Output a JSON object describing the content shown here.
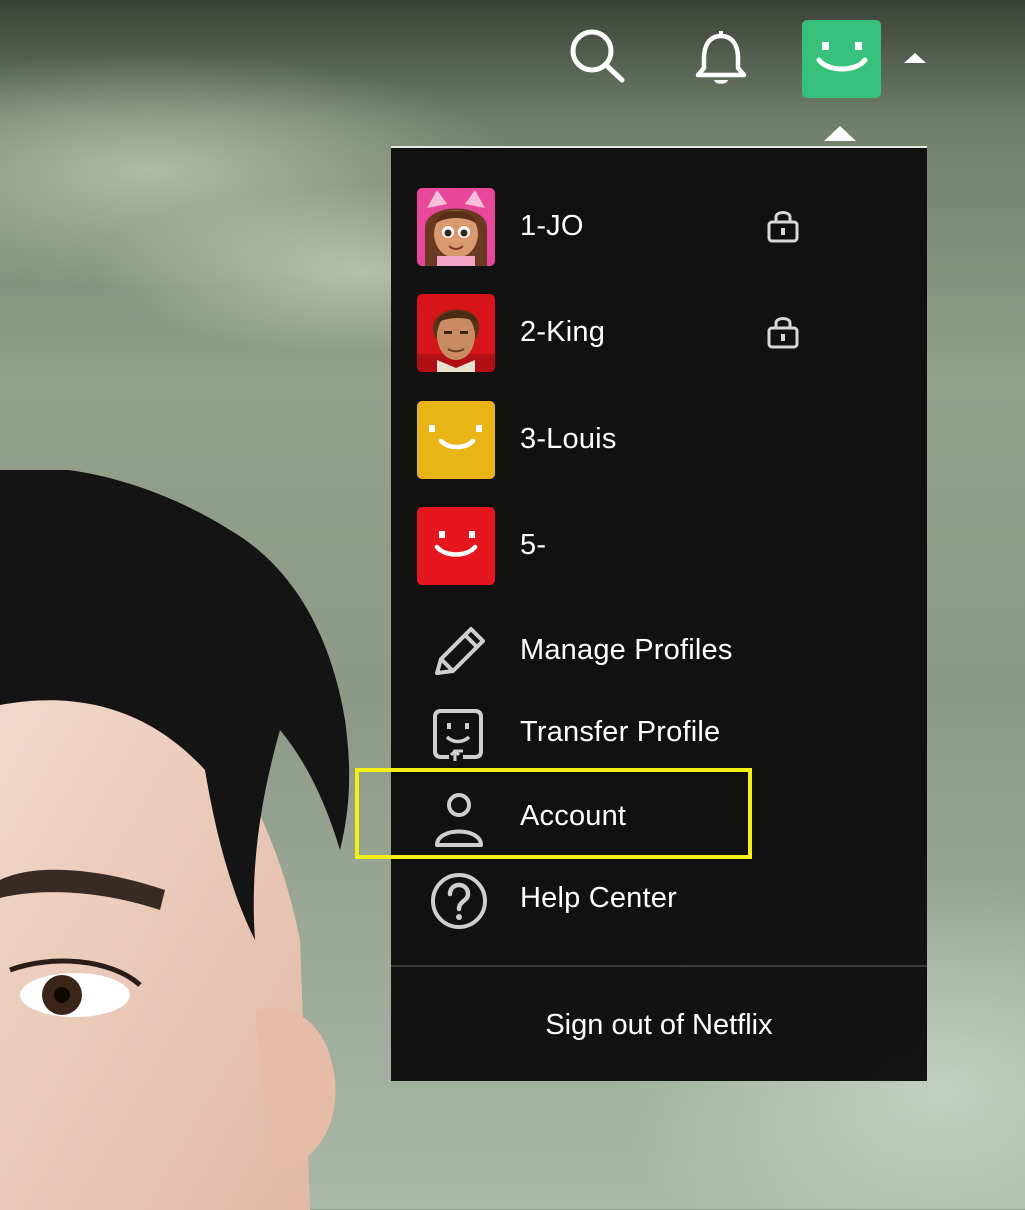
{
  "header": {
    "search_icon": "search-icon",
    "notifications_icon": "bell-icon",
    "current_profile_color": "#35c17a"
  },
  "profiles": [
    {
      "name": "1-JO",
      "locked": true,
      "avatar": "cartoon-girl-cat-ears-avatar",
      "color": "#e8479b"
    },
    {
      "name": "2-King",
      "locked": true,
      "avatar": "cartoon-man-avatar",
      "color": "#d8141b"
    },
    {
      "name": "3-Louis",
      "locked": false,
      "avatar": "smiley-face-avatar",
      "color": "#e9b415"
    },
    {
      "name": "5-",
      "locked": false,
      "avatar": "smiley-face-avatar",
      "color": "#e5161e"
    }
  ],
  "actions": {
    "manage_profiles": "Manage Profiles",
    "transfer_profile": "Transfer Profile",
    "account": "Account",
    "help_center": "Help Center"
  },
  "sign_out": "Sign out of Netflix",
  "highlight_color": "#f4ef14"
}
